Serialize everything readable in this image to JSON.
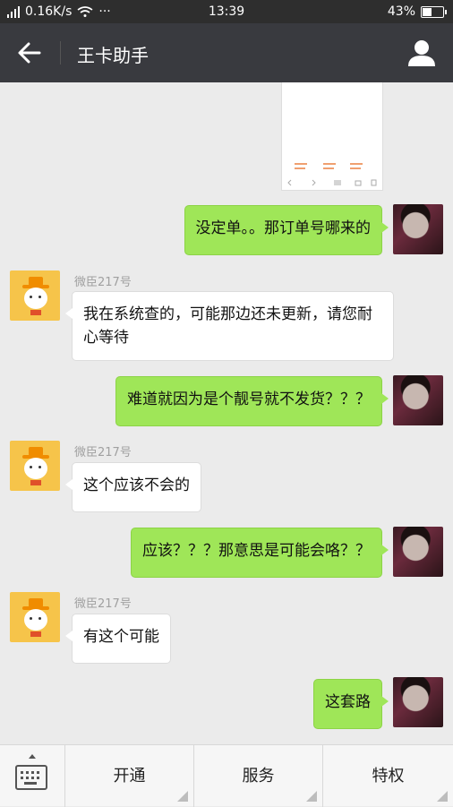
{
  "status_bar": {
    "network": "4G",
    "speed": "0.16K/s",
    "dots": "···",
    "time": "13:39",
    "battery_percent": "43%",
    "battery_level": 0.43
  },
  "header": {
    "title": "王卡助手"
  },
  "messages": [
    {
      "side": "right",
      "text": "没定单。。那订单号哪来的"
    },
    {
      "side": "left",
      "sender": "微臣217号",
      "text": "我在系统查的，可能那边还未更新，请您耐心等待"
    },
    {
      "side": "right",
      "text": "难道就因为是个靓号就不发货？？？"
    },
    {
      "side": "left",
      "sender": "微臣217号",
      "text": "这个应该不会的"
    },
    {
      "side": "right",
      "text": "应该？？？那意思是可能会咯？？"
    },
    {
      "side": "left",
      "sender": "微臣217号",
      "text": "有这个可能"
    },
    {
      "side": "right",
      "text": "这套路"
    }
  ],
  "bottom_menu": {
    "items": [
      "开通",
      "服务",
      "特权"
    ]
  },
  "colors": {
    "title_bar": "#393a3f",
    "status_bar": "#2e2e2e",
    "bubble_green": "#9fe658",
    "chat_bg": "#ebebeb"
  }
}
